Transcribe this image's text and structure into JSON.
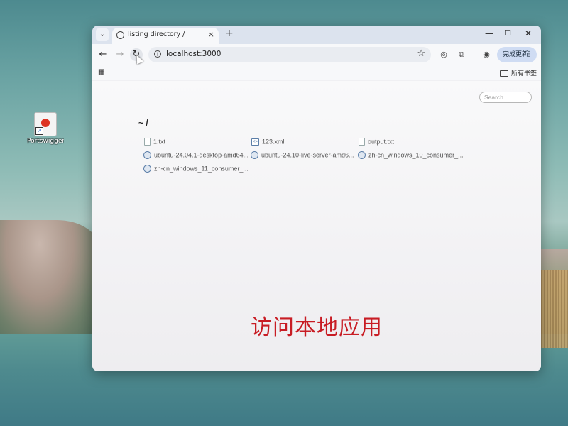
{
  "desktop": {
    "icon_label": "PortswiggerB..."
  },
  "browser": {
    "tab": {
      "title": "listing directory /",
      "close": "×"
    },
    "new_tab": "+",
    "tab_search": "⌄",
    "window_controls": {
      "minimize": "—",
      "maximize": "☐",
      "close": "✕"
    },
    "toolbar": {
      "back": "←",
      "forward": "→",
      "reload": "↻",
      "url": "localhost:3000",
      "star": "☆",
      "update_label": "完成更新",
      "menu": "⋮"
    },
    "bookmarks": {
      "all_bookmarks": "所有书签"
    }
  },
  "page": {
    "search_placeholder": "Search",
    "heading": "~ /",
    "files": [
      {
        "name": "1.txt",
        "icon": "text-file-icon"
      },
      {
        "name": "123.xml",
        "icon": "xml-file-icon"
      },
      {
        "name": "output.txt",
        "icon": "text-file-icon"
      },
      {
        "name": "ubuntu-24.04.1-desktop-amd64...",
        "icon": "disc-image-icon"
      },
      {
        "name": "ubuntu-24.10-live-server-amd6...",
        "icon": "disc-image-icon"
      },
      {
        "name": "zh-cn_windows_10_consumer_...",
        "icon": "disc-image-icon"
      },
      {
        "name": "zh-cn_windows_11_consumer_...",
        "icon": "disc-image-icon"
      }
    ]
  },
  "overlay_caption": "访问本地应用",
  "colors": {
    "caption": "#c81c24",
    "accent": "#cfdcf3"
  }
}
